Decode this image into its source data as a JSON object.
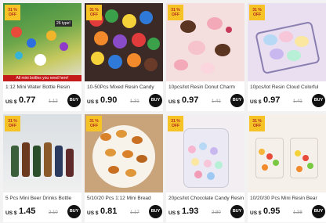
{
  "colors": {
    "accent": "#f6c327",
    "buy_button": "#111111",
    "price": "#111111"
  },
  "products": [
    {
      "badge": "31 % OFF",
      "banner": "All mini bottles you need here!",
      "title": "1:12 Mini Water Bottle Resin",
      "currency": "US $",
      "price": "0.77",
      "old_price": "1.12",
      "buy_label": "BUY"
    },
    {
      "badge": "31 % OFF",
      "title": "10-50Pcs Mixed Resin Candy",
      "currency": "US $",
      "price": "0.90",
      "old_price": "1.31",
      "buy_label": "BUY"
    },
    {
      "badge": "31 % OFF",
      "title": "10pcs/lot Resin Donut Charm",
      "currency": "US $",
      "price": "0.97",
      "old_price": "1.41",
      "buy_label": "BUY"
    },
    {
      "badge": "31 % OFF",
      "title": "10pcs/lot Resin Cloud Colorful",
      "currency": "US $",
      "price": "0.97",
      "old_price": "1.41",
      "buy_label": "BUY"
    },
    {
      "badge": "31 % OFF",
      "title": "5 Pcs Mini Beer Drinks Bottle",
      "currency": "US $",
      "price": "1.45",
      "old_price": "2.10",
      "buy_label": "BUY"
    },
    {
      "badge": "31 % OFF",
      "title": "5/10/20 Pcs 1:12 Mini Bread",
      "currency": "US $",
      "price": "0.81",
      "old_price": "1.17",
      "buy_label": "BUY"
    },
    {
      "badge": "31 % OFF",
      "title": "20pcs/lot Chocolate Candy Resin",
      "currency": "US $",
      "price": "1.93",
      "old_price": "2.80",
      "buy_label": "BUY"
    },
    {
      "badge": "31 % OFF",
      "title": "10/20/30 Pcs Mini Resin Bear",
      "currency": "US $",
      "price": "0.95",
      "old_price": "1.38",
      "buy_label": "BUY"
    }
  ]
}
